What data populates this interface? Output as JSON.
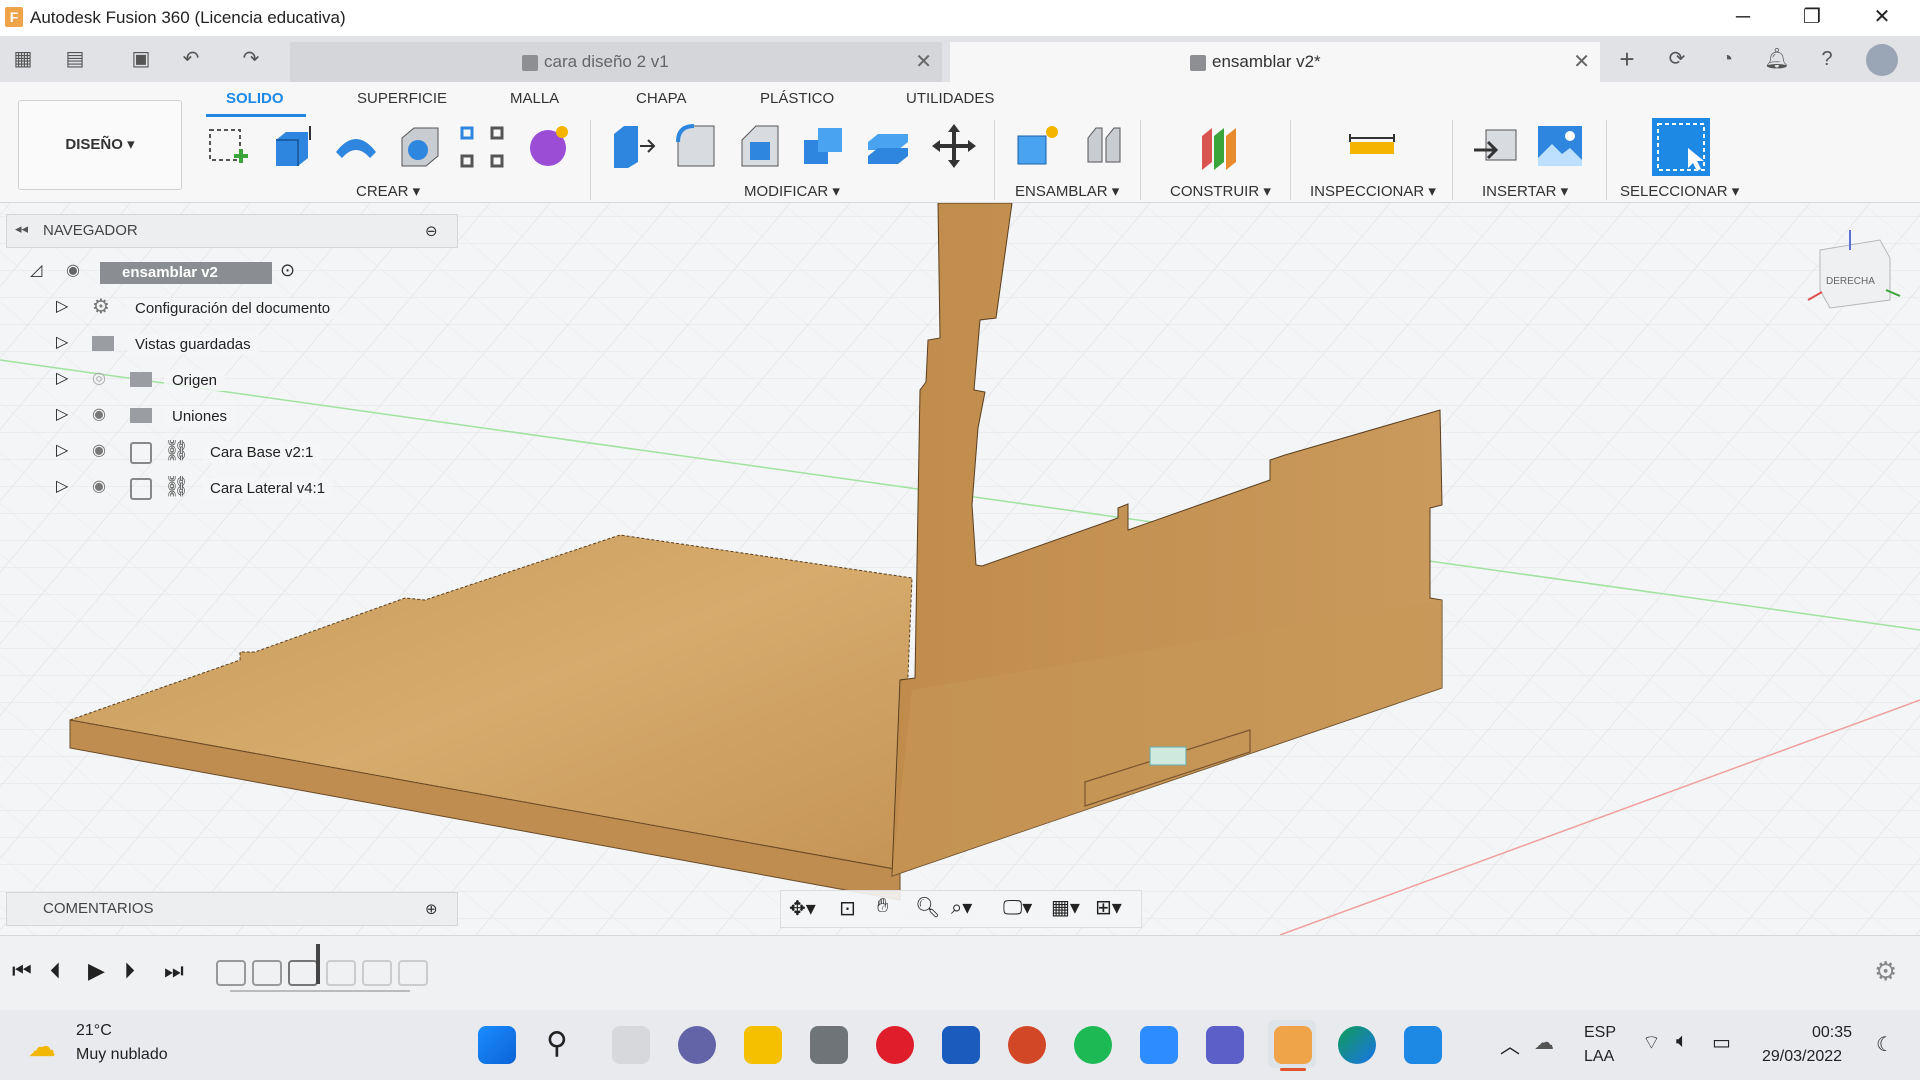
{
  "window": {
    "title": "Autodesk Fusion 360 (Licencia educativa)",
    "app_icon": "F",
    "controls": [
      "─",
      "❐",
      "✕"
    ]
  },
  "tabs": [
    {
      "label": "cara diseño 2 v1",
      "active": false
    },
    {
      "label": "ensamblar v2*",
      "active": true
    }
  ],
  "ribbon": {
    "workspace": "DISEÑO",
    "tabs": [
      "SOLIDO",
      "SUPERFICIE",
      "MALLA",
      "CHAPA",
      "PLÁSTICO",
      "UTILIDADES"
    ],
    "groups": [
      "CREAR",
      "MODIFICAR",
      "ENSAMBLAR",
      "CONSTRUIR",
      "INSPECCIONAR",
      "INSERTAR",
      "SELECCIONAR"
    ]
  },
  "navigator": {
    "title": "NAVEGADOR",
    "root": "ensamblar v2",
    "items": [
      {
        "label": "Configuración del documento",
        "icon": "gear-icon"
      },
      {
        "label": "Vistas guardadas",
        "icon": "folder-icon"
      },
      {
        "label": "Origen",
        "icon": "folder-icon"
      },
      {
        "label": "Uniones",
        "icon": "folder-icon"
      },
      {
        "label": "Cara Base v2:1",
        "icon": "component-icon"
      },
      {
        "label": "Cara Lateral v4:1",
        "icon": "component-icon"
      }
    ]
  },
  "comments": {
    "title": "COMENTARIOS"
  },
  "viewcube": {
    "face": "DERECHA"
  },
  "taskbar": {
    "weather_temp": "21°C",
    "weather_desc": "Muy nublado",
    "lang1": "ESP",
    "lang2": "LAA",
    "time": "00:35",
    "date": "29/03/2022"
  },
  "colors": {
    "accent": "#1e88e5",
    "wood": "#c99a5a",
    "select": "#1e88e5"
  }
}
